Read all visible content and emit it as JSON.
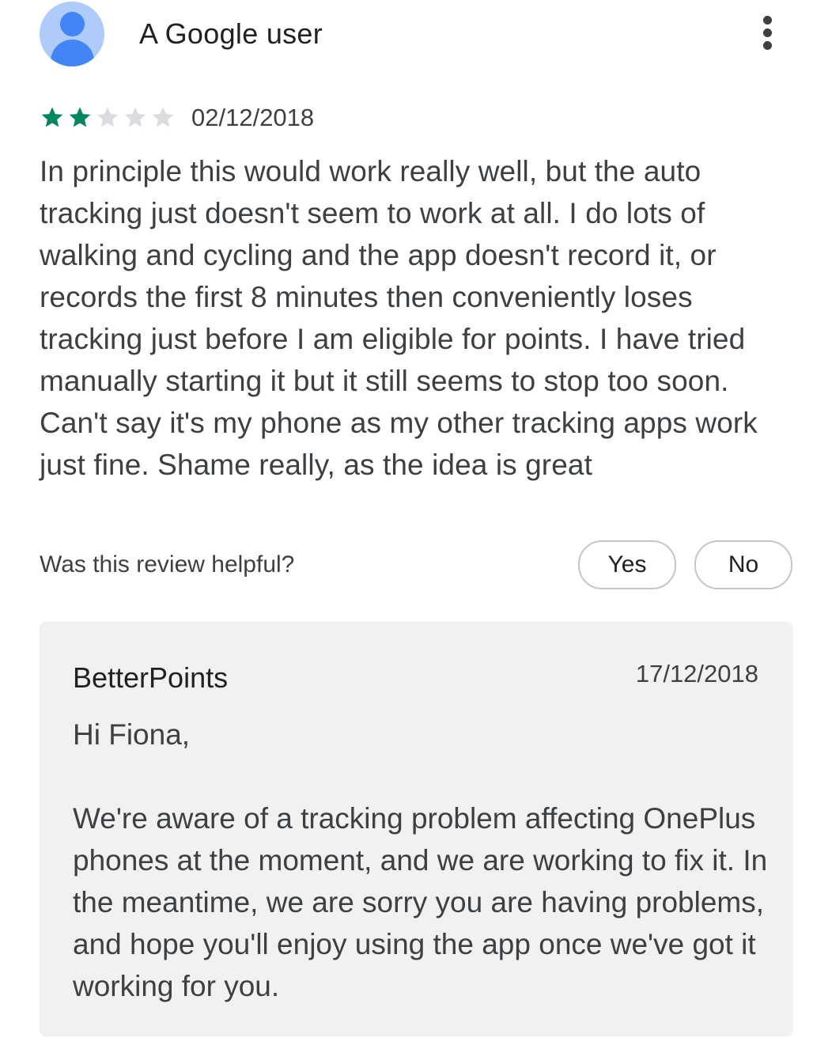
{
  "review": {
    "author": "A Google user",
    "rating": 2,
    "rating_max": 5,
    "date": "02/12/2018",
    "text": "In principle this would work really well, but the auto tracking just doesn't seem to work at all. I do lots of walking and cycling and the app doesn't record it, or records the first 8 minutes then conveniently loses tracking just before I am eligible for points. I have tried manually starting it but it still seems to stop too soon. Can't say it's my phone as my other tracking apps work just fine. Shame really, as the idea is great"
  },
  "helpful": {
    "question": "Was this review helpful?",
    "yes_label": "Yes",
    "no_label": "No"
  },
  "developer_reply": {
    "name": "BetterPoints",
    "date": "17/12/2018",
    "greeting": "Hi Fiona,",
    "body": "We're aware of a tracking problem affecting OnePlus phones at the moment, and we are working to fix it. In the meantime, we are sorry you are having problems, and hope you'll enjoy using the app once we've got it working for you."
  },
  "icons": {
    "avatar": "person-avatar-icon",
    "more": "more-vert-icon",
    "star_filled": "star-filled-icon",
    "star_empty": "star-empty-icon"
  },
  "colors": {
    "star_filled": "#01875f",
    "star_empty": "#dadce0",
    "avatar_bg": "#aecbfa",
    "avatar_fg": "#4285f4",
    "reply_bg": "#f1f1f1"
  }
}
